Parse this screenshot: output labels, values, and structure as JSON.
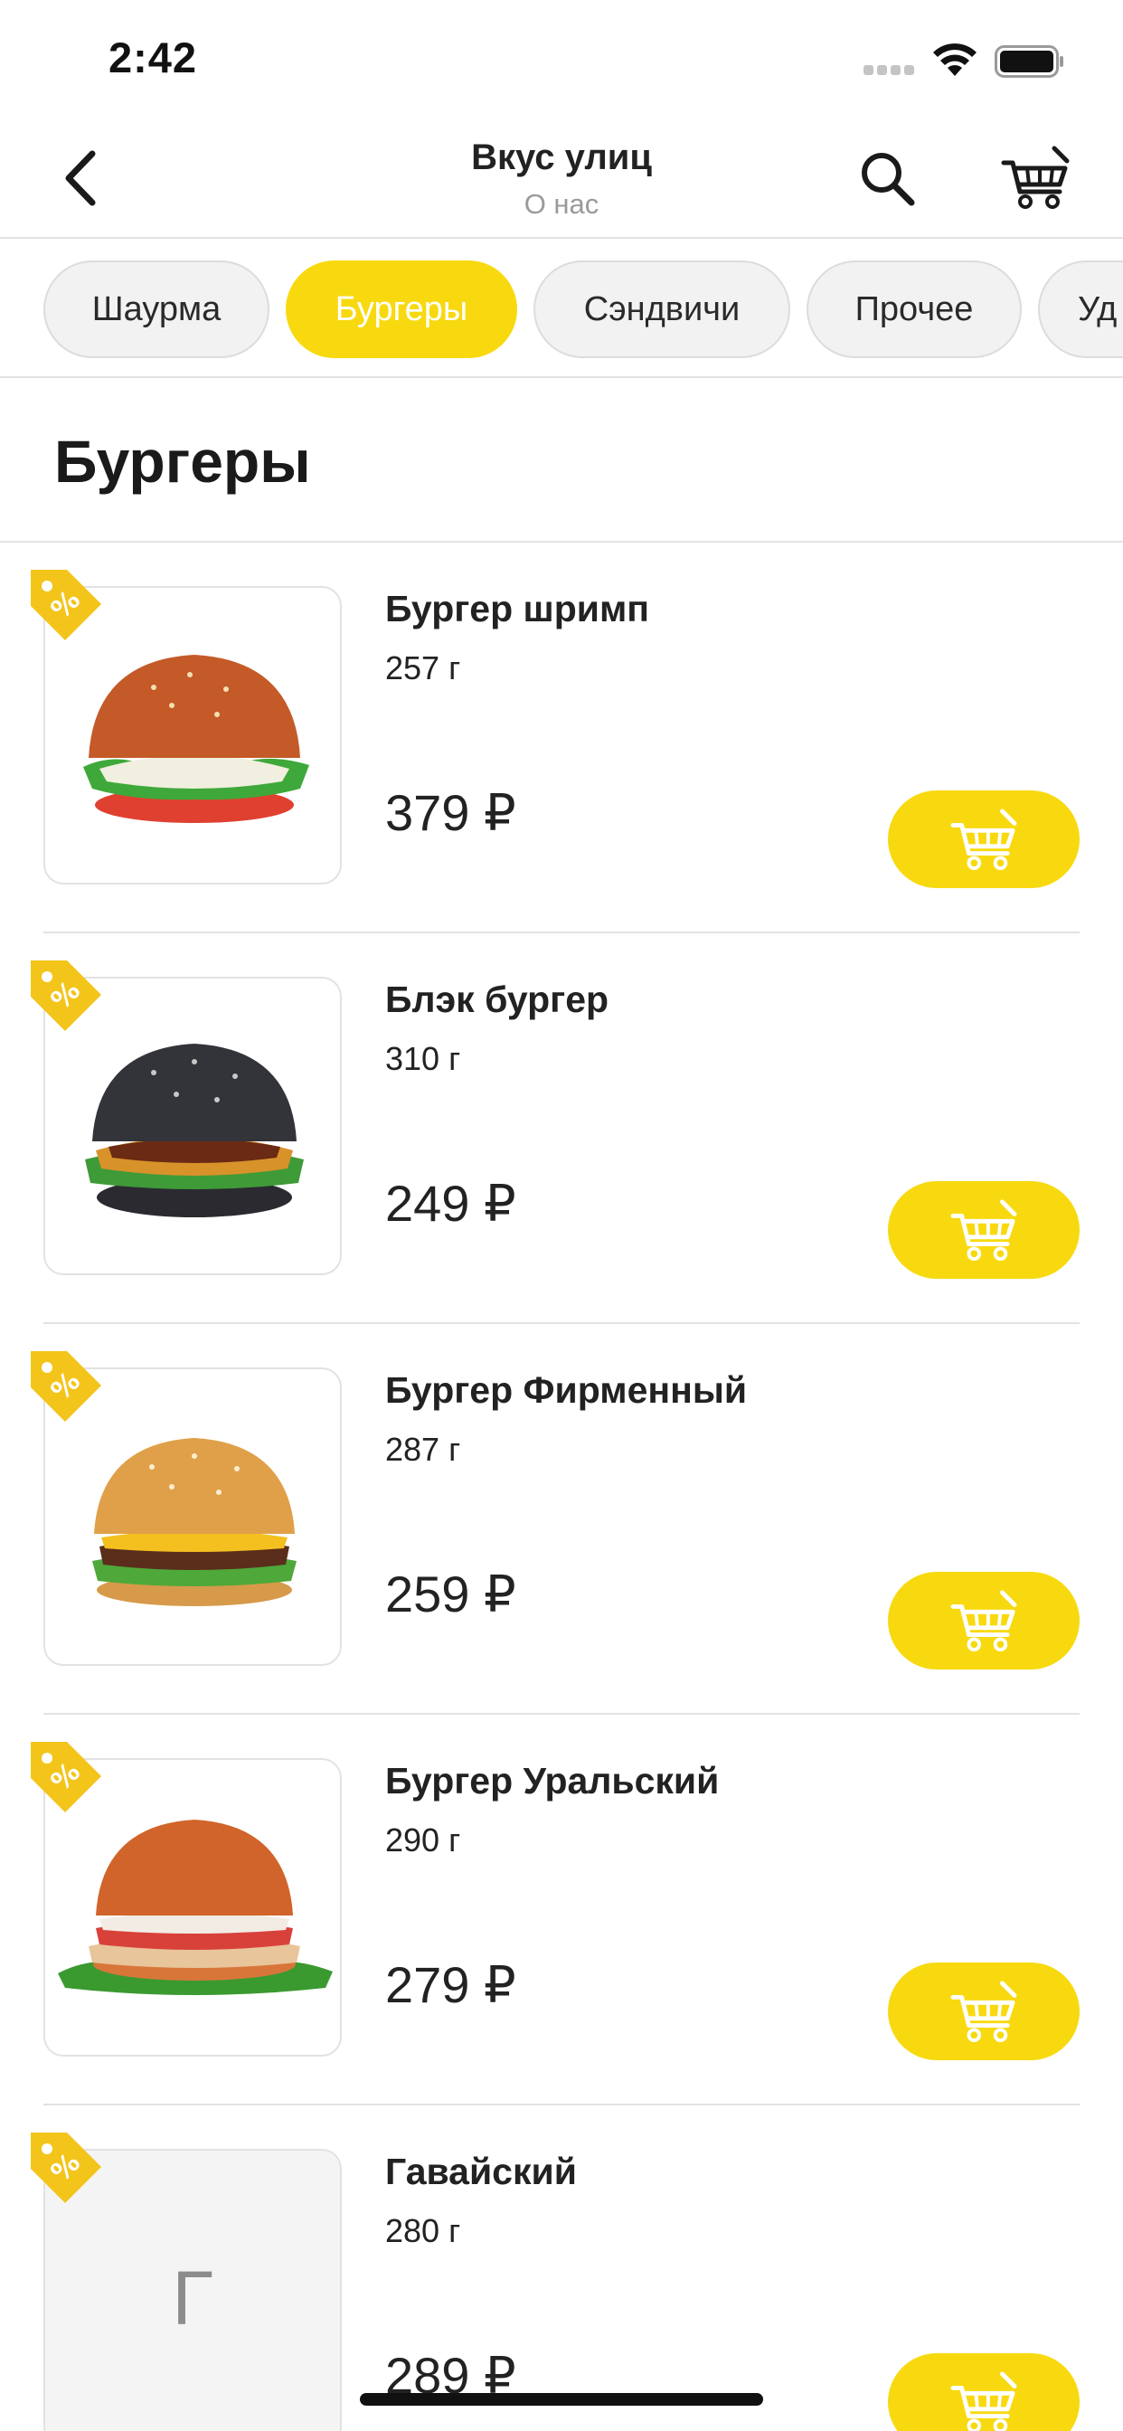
{
  "status_bar": {
    "time": "2:42"
  },
  "header": {
    "title": "Вкус улиц",
    "subtitle": "О нас",
    "icons": {
      "back": "chevron-left-icon",
      "search": "search-icon",
      "cart": "cart-icon"
    }
  },
  "tabs": [
    {
      "label": "Шаурма",
      "active": false
    },
    {
      "label": "Бургеры",
      "active": true
    },
    {
      "label": "Сэндвичи",
      "active": false
    },
    {
      "label": "Прочее",
      "active": false
    },
    {
      "label": "Уд",
      "active": false
    }
  ],
  "section_title": "Бургеры",
  "products": [
    {
      "name": "Бургер шримп",
      "weight": "257 г",
      "price": "379 ₽",
      "image": "burger-shrimp",
      "discount_icon": "percent-tag-icon"
    },
    {
      "name": "Блэк бургер",
      "weight": "310 г",
      "price": "249 ₽",
      "image": "burger-black",
      "discount_icon": "percent-tag-icon"
    },
    {
      "name": "Бургер Фирменный",
      "weight": "287 г",
      "price": "259 ₽",
      "image": "burger-signature",
      "discount_icon": "percent-tag-icon"
    },
    {
      "name": "Бургер Уральский",
      "weight": "290 г",
      "price": "279 ₽",
      "image": "burger-ural",
      "discount_icon": "percent-tag-icon"
    },
    {
      "name": "Гавайский",
      "weight": "280 г",
      "price": "289 ₽",
      "image_placeholder": "Г",
      "discount_icon": "percent-tag-icon"
    }
  ],
  "colors": {
    "accent": "#F8D90F",
    "divider": "#E3E3E3",
    "text": "#1F1F1F",
    "muted": "#9A9A9A",
    "badge": "#F3C41A"
  }
}
